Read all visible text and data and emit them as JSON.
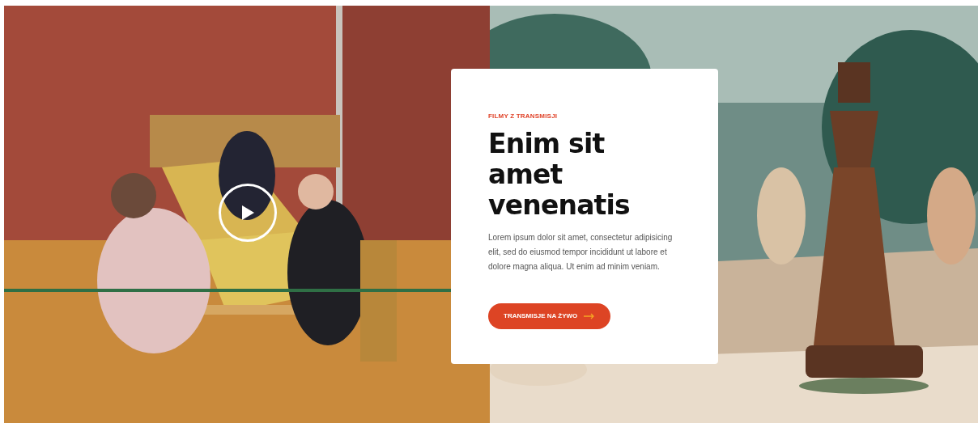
{
  "card": {
    "eyebrow": "FILMY Z TRANSMISJI",
    "title": "Enim sit amet venenatis",
    "body": "Lorem ipsum dolor sit amet, consectetur adipisicing elit, sed do eiusmod tempor incididunt ut labore et dolore magna aliqua. Ut enim ad minim veniam.",
    "button": "TRANSMISJE NA ŻYWO"
  }
}
